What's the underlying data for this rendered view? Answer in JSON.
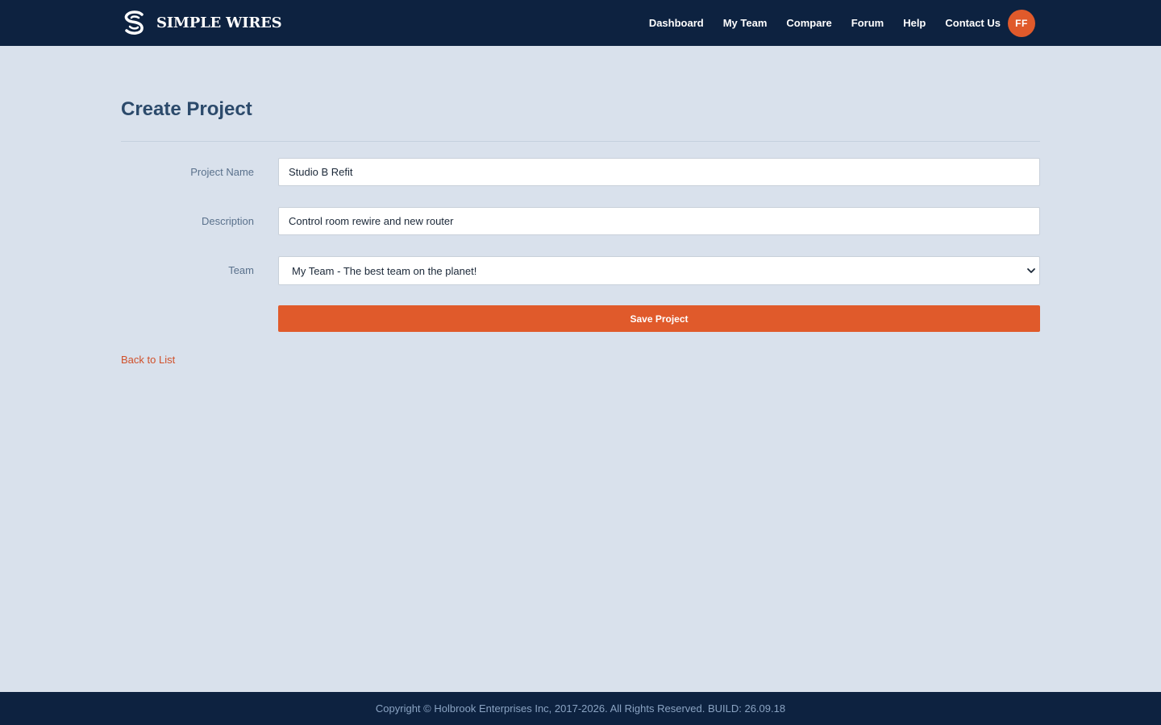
{
  "header": {
    "brand_name": "SIMPLE WIRES",
    "logo_icon": "simple-wires-logo-icon",
    "nav": [
      {
        "label": "Dashboard"
      },
      {
        "label": "My Team"
      },
      {
        "label": "Compare"
      },
      {
        "label": "Forum"
      },
      {
        "label": "Help"
      },
      {
        "label": "Contact Us"
      }
    ],
    "avatar_initials": "FF"
  },
  "main": {
    "title": "Create Project",
    "form": {
      "project_name": {
        "label": "Project Name",
        "value": "Studio B Refit"
      },
      "description": {
        "label": "Description",
        "value": "Control room rewire and new router"
      },
      "team": {
        "label": "Team",
        "selected": "My Team - The best team on the planet!",
        "icon": "chevron-down-icon"
      },
      "save_label": "Save Project"
    },
    "back_link": "Back to List"
  },
  "footer": {
    "copyright": "Copyright © Holbrook Enterprises Inc, 2017-2026. All Rights Reserved. BUILD: 26.09.18"
  },
  "colors": {
    "header_bg": "#0d2240",
    "page_bg": "#d9e1ec",
    "accent": "#e05a2b",
    "title": "#2c4a6b",
    "label": "#5a718c",
    "footer_text": "#8aa3c2"
  }
}
